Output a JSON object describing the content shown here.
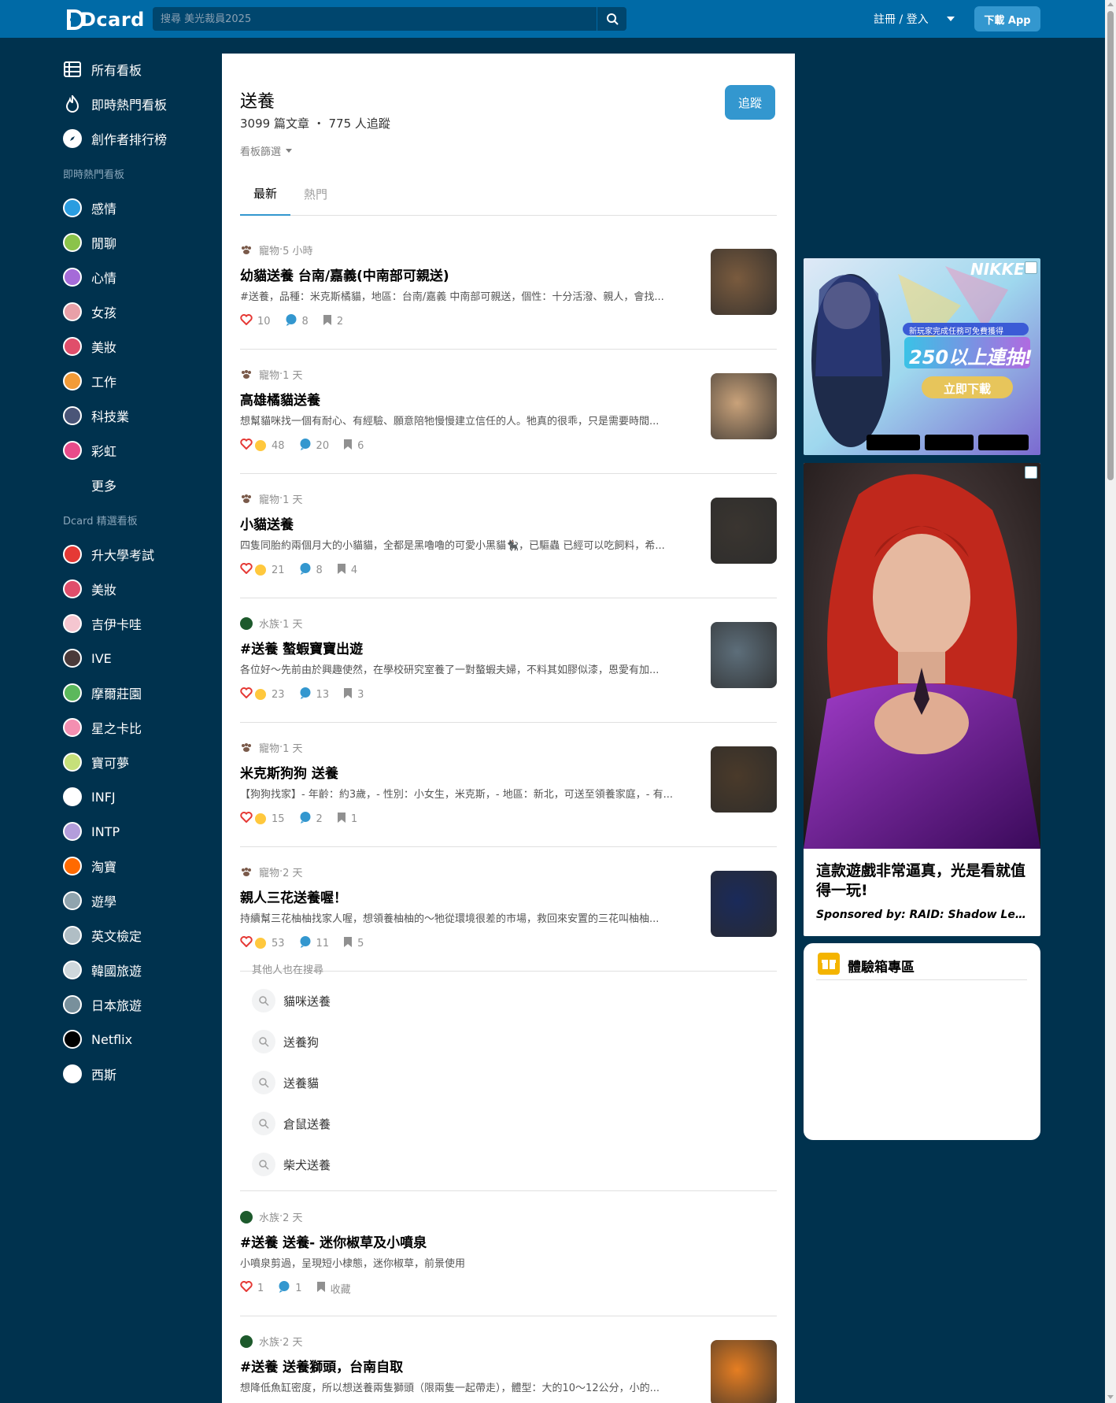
{
  "header": {
    "logo": "Dcard",
    "search_placeholder": "搜尋 美光裁員2025",
    "login": "註冊 / 登入",
    "download": "下載 App"
  },
  "colors": {
    "header_bg": "#006aa6",
    "page_bg": "#00324e",
    "accent": "#3397cf"
  },
  "sidebar": {
    "main_items": [
      {
        "label": "所有看板",
        "icon": "boards-icon"
      },
      {
        "label": "即時熱門看板",
        "icon": "fire-icon"
      },
      {
        "label": "創作者排行榜",
        "icon": "compass-icon"
      }
    ],
    "hot_heading": "即時熱門看板",
    "hot_items": [
      {
        "label": "感情",
        "icon": "heart-forum-icon",
        "color": "#2a9de0"
      },
      {
        "label": "閒聊",
        "icon": "chat-forum-icon",
        "color": "#8bc34a"
      },
      {
        "label": "心情",
        "icon": "mood-forum-icon",
        "color": "#a56bd8"
      },
      {
        "label": "女孩",
        "icon": "girl-forum-icon",
        "color": "#e8a0a8"
      },
      {
        "label": "美妝",
        "icon": "makeup-forum-icon",
        "color": "#e04e6b"
      },
      {
        "label": "工作",
        "icon": "work-forum-icon",
        "color": "#f29b38"
      },
      {
        "label": "科技業",
        "icon": "tech-forum-icon",
        "color": "#4a5578"
      },
      {
        "label": "彩虹",
        "icon": "rainbow-forum-icon",
        "color": "#e94b8a"
      }
    ],
    "more": "更多",
    "featured_heading": "Dcard 精選看板",
    "featured_items": [
      {
        "label": "升大學考試",
        "icon": "exam-forum-icon",
        "color": "#e53935"
      },
      {
        "label": "美妝",
        "icon": "makeup-forum-icon",
        "color": "#e04e6b"
      },
      {
        "label": "吉伊卡哇",
        "icon": "chiikawa-forum-icon",
        "color": "#f5c6d0"
      },
      {
        "label": "IVE",
        "icon": "ive-forum-icon",
        "color": "#4a3a3a"
      },
      {
        "label": "摩爾莊園",
        "icon": "mole-forum-icon",
        "color": "#5cb85c"
      },
      {
        "label": "星之卡比",
        "icon": "kirby-forum-icon",
        "color": "#f48fb1"
      },
      {
        "label": "寶可夢",
        "icon": "pokemon-forum-icon",
        "color": "#c6e07a"
      },
      {
        "label": "INFJ",
        "icon": "infj-forum-icon",
        "color": "#ffffff"
      },
      {
        "label": "INTP",
        "icon": "intp-forum-icon",
        "color": "#b39ddb"
      },
      {
        "label": "淘寶",
        "icon": "taobao-forum-icon",
        "color": "#ff6a00"
      },
      {
        "label": "遊學",
        "icon": "study-abroad-forum-icon",
        "color": "#90a4ae"
      },
      {
        "label": "英文檢定",
        "icon": "english-forum-icon",
        "color": "#b0bec5"
      },
      {
        "label": "韓國旅遊",
        "icon": "korea-forum-icon",
        "color": "#cfd8dc"
      },
      {
        "label": "日本旅遊",
        "icon": "japan-forum-icon",
        "color": "#78909c"
      },
      {
        "label": "Netflix",
        "icon": "netflix-forum-icon",
        "color": "#000000"
      },
      {
        "label": "西斯",
        "icon": "adult-forum-icon",
        "color": "#ffffff"
      }
    ]
  },
  "forum": {
    "title": "送養",
    "meta": "3099 篇文章 ・ 775 人追蹤",
    "filter": "看板篩選",
    "follow": "追蹤",
    "tabs": [
      "最新",
      "熱門"
    ]
  },
  "posts": [
    {
      "category": "寵物",
      "time": "5 小時",
      "title": "幼貓送養 台南/嘉義(中南部可親送)",
      "excerpt": "#送養，品種：米克斯橘貓，地區：台南/嘉義 中南部可親送，個性：十分活潑、親人，會找...",
      "likes": "10",
      "comments": "8",
      "saves": "2",
      "thumb_color": "#7a5b3e"
    },
    {
      "category": "寵物",
      "time": "1 天",
      "title": "高雄橘貓送養",
      "excerpt": "想幫貓咪找一個有耐心、有經驗、願意陪牠慢慢建立信任的人。牠真的很乖，只是需要時間...",
      "likes": "48",
      "comments": "20",
      "saves": "6",
      "thumb_color": "#c9a27a"
    },
    {
      "category": "寵物",
      "time": "1 天",
      "title": "小貓送養",
      "excerpt": "四隻同胎約兩個月大的小貓貓，全都是黑嚕嚕的可愛小黑貓🐈‍⬛，已驅蟲 已經可以吃飼料，希...",
      "likes": "21",
      "comments": "8",
      "saves": "4",
      "thumb_color": "#3a3530"
    },
    {
      "category": "水族",
      "time": "1 天",
      "title": "#送養 螯蝦寶寶出遊",
      "excerpt": "各位好～先前由於興趣使然，在學校研究室養了一對螯蝦夫婦，不料其如膠似漆，恩愛有加...",
      "likes": "23",
      "comments": "13",
      "saves": "3",
      "thumb_color": "#5d6e7a"
    },
    {
      "category": "寵物",
      "time": "1 天",
      "title": "米克斯狗狗 送養",
      "excerpt": "【狗狗找家】- 年齡：約3歲，- 性別：小女生，米克斯，- 地區：新北，可送至領養家庭，- 有...",
      "likes": "15",
      "comments": "2",
      "saves": "1",
      "thumb_color": "#4a3a2a"
    },
    {
      "category": "寵物",
      "time": "2 天",
      "title": "親人三花送養喔！",
      "excerpt": "持續幫三花柚柚找家人喔，想領養柚柚的～牠從環境很差的市場，救回來安置的三花叫柚柚...",
      "likes": "53",
      "comments": "11",
      "saves": "5",
      "thumb_color": "#1a2a5a"
    }
  ],
  "related": {
    "title": "其他人也在搜尋",
    "items": [
      "貓咪送養",
      "送養狗",
      "送養貓",
      "倉鼠送養",
      "柴犬送養"
    ]
  },
  "posts_after": [
    {
      "category": "水族",
      "time": "2 天",
      "title": "#送養 送養- 迷你椒草及小噴泉",
      "excerpt": "小噴泉剪過，呈現短小棣態，迷你椒草，前景使用",
      "likes": "1",
      "comments": "1",
      "saves": "收藏"
    },
    {
      "category": "水族",
      "time": "2 天",
      "title": "#送養 送養獅頭，台南自取",
      "excerpt": "想降低魚缸密度，所以想送養兩隻獅頭（限兩隻一起帶走），體型：大的10～12公分，小的...",
      "likes": "",
      "comments": "",
      "saves": "",
      "thumb_color": "#e67e22"
    }
  ],
  "ads": {
    "nikke_brand": "NIKKE",
    "nikke_tagline": "新玩家完成任務可免費獲得",
    "nikke_headline": "250以上連抽!",
    "nikke_cta": "立即下載",
    "ad2_title": "這款遊戲非常逼真，光是看就值得一玩!",
    "ad2_sponsor": "Sponsored by: RAID: Shadow Legends"
  },
  "experience_box": {
    "title": "體驗箱專區"
  }
}
